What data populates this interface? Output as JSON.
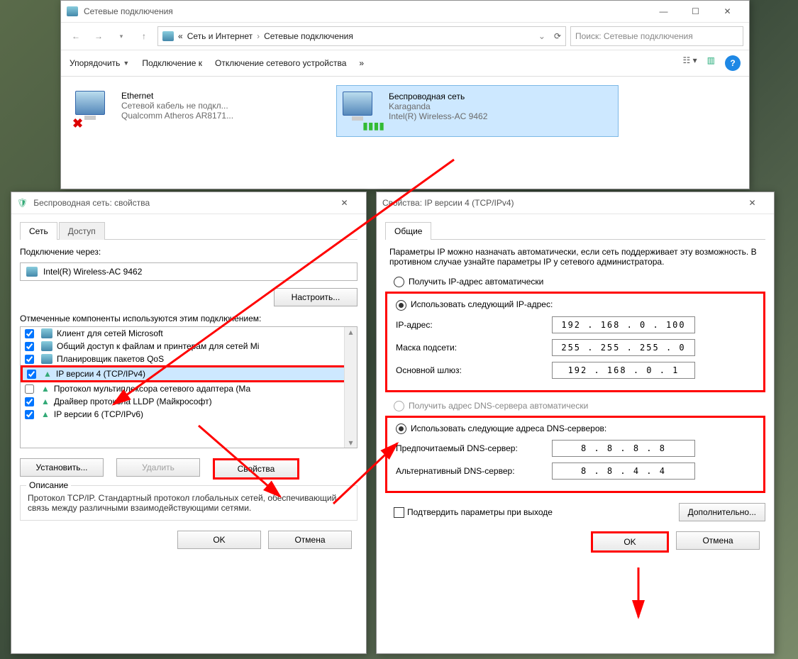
{
  "main": {
    "title": "Сетевые подключения",
    "breadcrumb": {
      "root": "«",
      "p1": "Сеть и Интернет",
      "p2": "Сетевые подключения"
    },
    "search_ph": "Поиск: Сетевые подключения",
    "cmd": {
      "organize": "Упорядочить",
      "connect": "Подключение к",
      "disable": "Отключение сетевого устройства",
      "more": "»"
    },
    "ethernet": {
      "name": "Ethernet",
      "status": "Сетевой кабель не подкл...",
      "adapter": "Qualcomm Atheros AR8171..."
    },
    "wifi": {
      "name": "Беспроводная сеть",
      "status": "Karaganda",
      "adapter": "Intel(R) Wireless-AC 9462"
    }
  },
  "props": {
    "title": "Беспроводная сеть: свойства",
    "tabs": {
      "net": "Сеть",
      "access": "Доступ"
    },
    "conn_via": "Подключение через:",
    "adapter": "Intel(R) Wireless-AC 9462",
    "configure": "Настроить...",
    "components_lbl": "Отмеченные компоненты используются этим подключением:",
    "items": [
      "Клиент для сетей Microsoft",
      "Общий доступ к файлам и принтерам для сетей Mi",
      "Планировщик пакетов QoS",
      "IP версии 4 (TCP/IPv4)",
      "Протокол мультиплексора сетевого адаптера (Ма",
      "Драйвер протокола LLDP (Майкрософт)",
      "IP версии 6 (TCP/IPv6)"
    ],
    "install": "Установить...",
    "remove": "Удалить",
    "properties": "Свойства",
    "desc_title": "Описание",
    "desc": "Протокол TCP/IP. Стандартный протокол глобальных сетей, обеспечивающий связь между различными взаимодействующими сетями.",
    "ok": "OK",
    "cancel": "Отмена"
  },
  "ipv4": {
    "title": "Свойства: IP версии 4 (TCP/IPv4)",
    "tab": "Общие",
    "info": "Параметры IP можно назначать автоматически, если сеть поддерживает эту возможность. В противном случае узнайте параметры IP у сетевого администратора.",
    "r_auto_ip": "Получить IP-адрес автоматически",
    "r_use_ip": "Использовать следующий IP-адрес:",
    "ip_lbl": "IP-адрес:",
    "mask_lbl": "Маска подсети:",
    "gw_lbl": "Основной шлюз:",
    "ip": "192 . 168 .  0  . 100",
    "mask": "255 . 255 . 255 .  0",
    "gw": "192 . 168 .  0  .  1",
    "r_auto_dns": "Получить адрес DNS-сервера автоматически",
    "r_use_dns": "Использовать следующие адреса DNS-серверов:",
    "dns1_lbl": "Предпочитаемый DNS-сервер:",
    "dns2_lbl": "Альтернативный DNS-сервер:",
    "dns1": "8  .  8  .  8  .  8",
    "dns2": "8  .  8  .  4  .  4",
    "validate": "Подтвердить параметры при выходе",
    "advanced": "Дополнительно...",
    "ok": "OK",
    "cancel": "Отмена"
  }
}
